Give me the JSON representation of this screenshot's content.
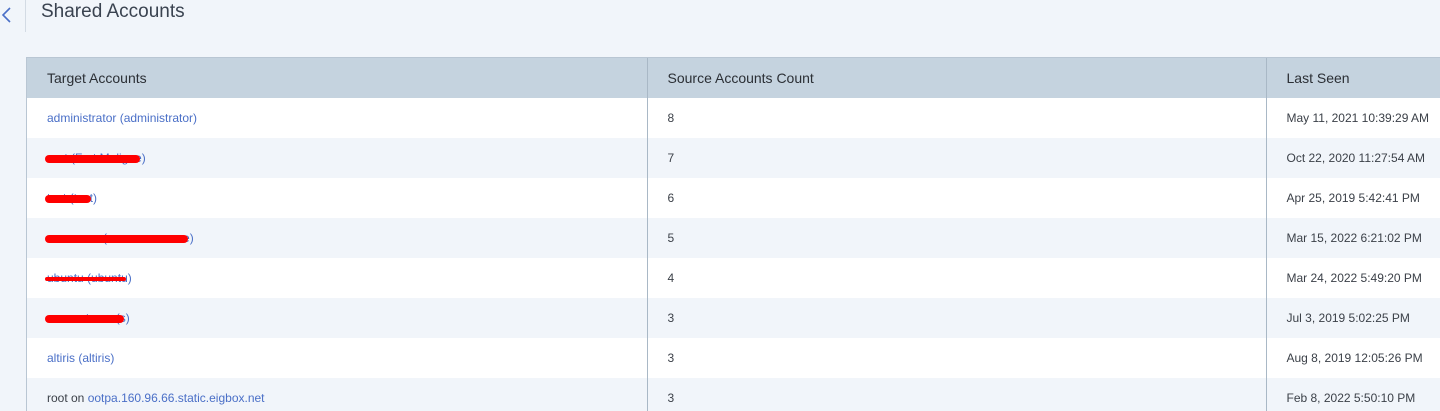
{
  "header": {
    "title": "Shared Accounts",
    "back_icon": "chevron-left-icon"
  },
  "colors": {
    "link": "#4a6fc7",
    "header_bg": "#c5d3df",
    "redaction": "#ff0000"
  },
  "table": {
    "columns": [
      "Target Accounts",
      "Source Accounts Count",
      "Last Seen"
    ],
    "rows": [
      {
        "prefix": "",
        "target": "administrator (administrator)",
        "count": "8",
        "last_seen": "May 11, 2021 10:39:29 AM"
      },
      {
        "prefix": "",
        "target": "root (Fort Meligne)",
        "count": "7",
        "last_seen": "Oct 22, 2020 11:27:54 AM"
      },
      {
        "prefix": "",
        "target": "test (test)",
        "count": "6",
        "last_seen": "Apr 25, 2019 5:42:41 PM"
      },
      {
        "prefix": "",
        "target": "someuser (someusername)",
        "count": "5",
        "last_seen": "Mar 15, 2022 6:21:02 PM"
      },
      {
        "prefix": "",
        "target": "ubuntu (ubuntu)",
        "count": "4",
        "last_seen": "Mar 24, 2022 5:49:20 PM"
      },
      {
        "prefix": "",
        "target": "accountuser (s)",
        "count": "3",
        "last_seen": "Jul 3, 2019 5:02:25 PM"
      },
      {
        "prefix": "",
        "target": "altiris (altiris)",
        "count": "3",
        "last_seen": "Aug 8, 2019 12:05:26 PM"
      },
      {
        "prefix": "root on",
        "target": "ootpa.160.96.66.static.eigbox.net",
        "count": "3",
        "last_seen": "Feb 8, 2022 5:50:10 PM"
      }
    ]
  }
}
